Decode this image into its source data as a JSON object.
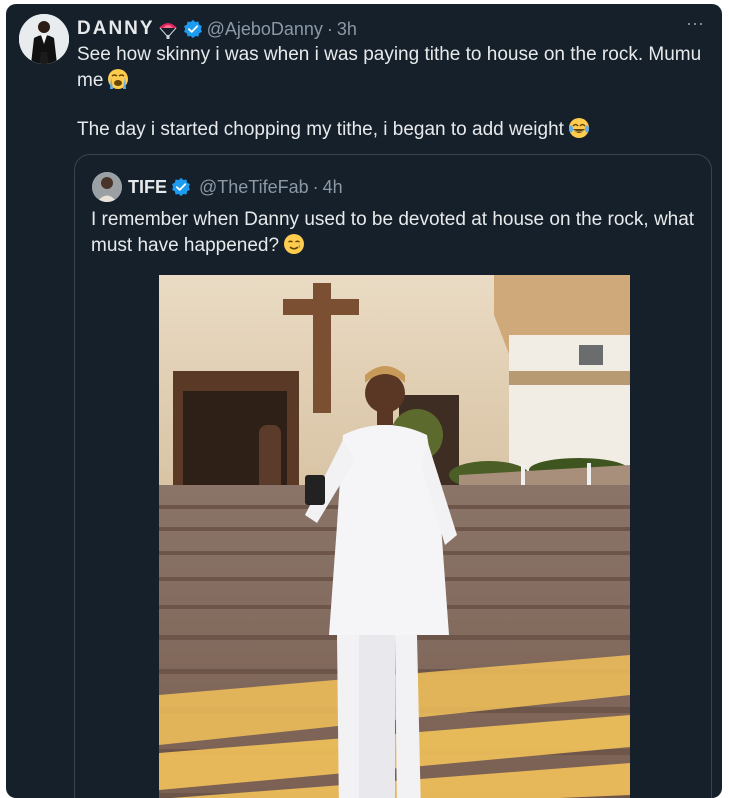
{
  "tweet": {
    "author_name": "DANNY",
    "author_handle": "@AjeboDanny",
    "separator": "·",
    "time": "3h",
    "more_label": "···",
    "text_line1": "See how skinny i was when i was paying tithe to house on the rock. Mumu me",
    "text_line2": "The day i started chopping my tithe, i began to add weight"
  },
  "quoted": {
    "author_name": "TIFE",
    "author_handle": "@TheTifeFab",
    "separator": "·",
    "time": "4h",
    "text": "I remember when Danny used to be devoted at house on the rock, what must have happened?"
  },
  "colors": {
    "background": "#15202b",
    "text": "#e7e9ea",
    "muted": "#8b98a5",
    "verified": "#1d9bf0",
    "border": "#38444d"
  },
  "icons": {
    "name_emoji": "parachute-emoji",
    "verified": "verified-badge-icon",
    "line1_emoji": "loudly-crying-face-emoji",
    "line2_emoji": "face-with-tears-of-joy-emoji",
    "quote_emoji": "smiling-face-with-tear-emoji"
  }
}
